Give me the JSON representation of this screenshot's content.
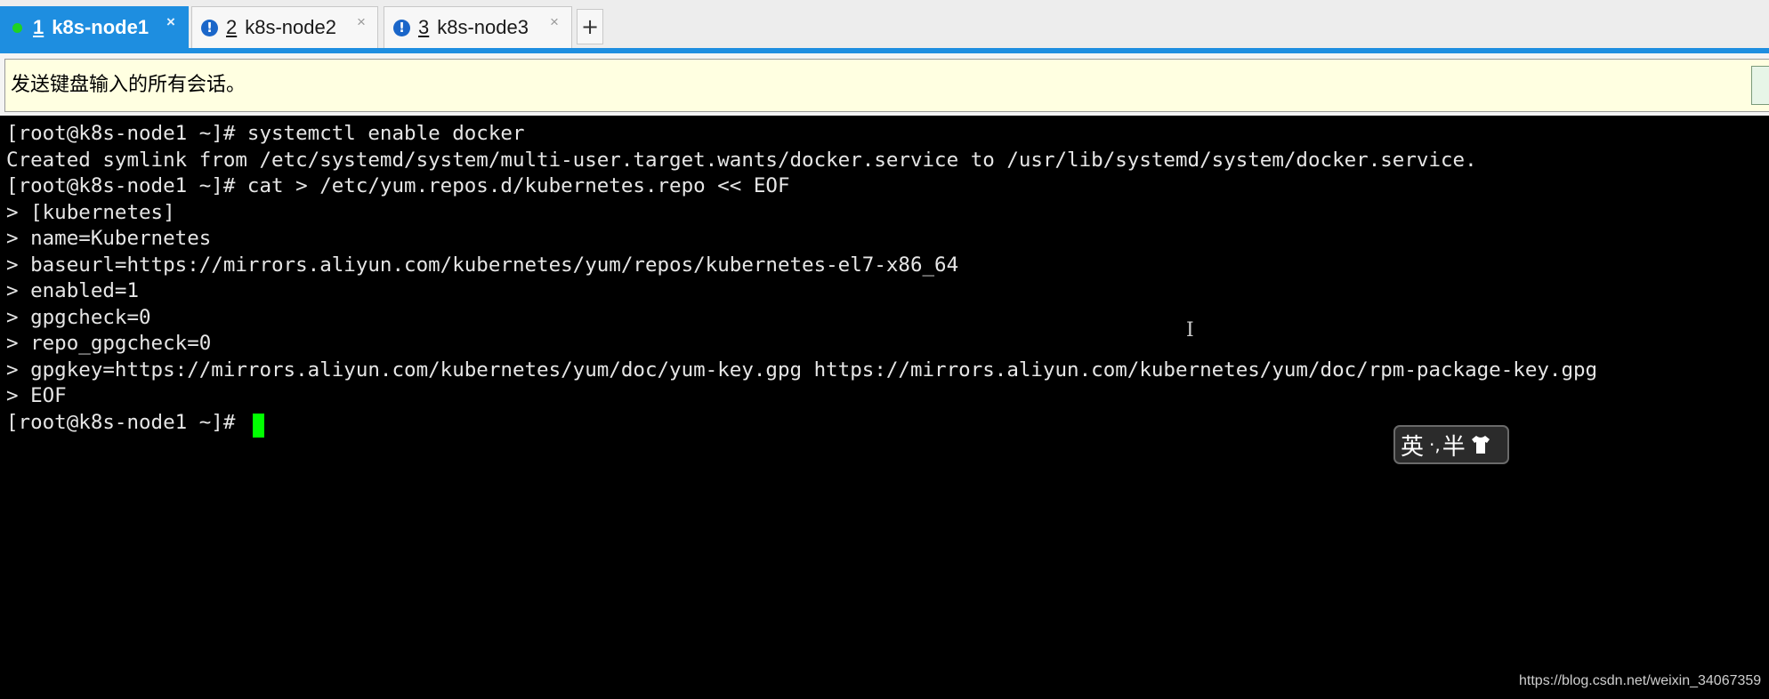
{
  "tabs": [
    {
      "number": "1",
      "label": "k8s-node1",
      "close": "×",
      "active": true,
      "status_icon": "green-dot-icon"
    },
    {
      "number": "2",
      "label": "k8s-node2",
      "close": "×",
      "active": false,
      "status_icon": "warning-icon"
    },
    {
      "number": "3",
      "label": "k8s-node3",
      "close": "×",
      "active": false,
      "status_icon": "warning-icon"
    }
  ],
  "tab_status": {
    "warning_glyph": "!"
  },
  "add_tab": {
    "label": "+"
  },
  "send_bar": {
    "placeholder": "发送键盘输入的所有会话。"
  },
  "terminal": {
    "lines": [
      "[root@k8s-node1 ~]# systemctl enable docker",
      "Created symlink from /etc/systemd/system/multi-user.target.wants/docker.service to /usr/lib/systemd/system/docker.service.",
      "[root@k8s-node1 ~]# cat > /etc/yum.repos.d/kubernetes.repo << EOF",
      "> [kubernetes]",
      "> name=Kubernetes",
      "> baseurl=https://mirrors.aliyun.com/kubernetes/yum/repos/kubernetes-el7-x86_64",
      "> enabled=1",
      "> gpgcheck=0",
      "> repo_gpgcheck=0",
      "> gpgkey=https://mirrors.aliyun.com/kubernetes/yum/doc/yum-key.gpg https://mirrors.aliyun.com/kubernetes/yum/doc/rpm-package-key.gpg",
      "> EOF",
      "[root@k8s-node1 ~]# "
    ],
    "mouse_cursor_glyph": "I"
  },
  "ime": {
    "lang": "英",
    "punct": "·,",
    "width": "半",
    "skin_icon": "shirt-icon"
  },
  "watermark": "https://blog.csdn.net/weixin_34067359",
  "colors": {
    "active_tab": "#1e8ee0",
    "terminal_bg": "#000000",
    "terminal_fg": "#e6e6e6",
    "cursor": "#00ff00",
    "send_bar_bg": "#ffffe1",
    "status_ok": "#1fd224",
    "status_warn": "#1a66c9"
  }
}
